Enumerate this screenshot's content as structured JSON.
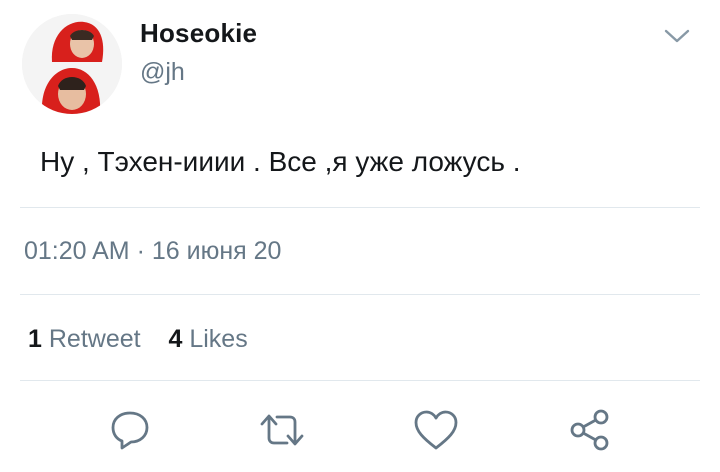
{
  "user": {
    "display_name": "Hoseokie",
    "handle": "@jh"
  },
  "tweet": {
    "text": "Ну , Тэхен-ииии . Все ,я уже ложусь .",
    "timestamp": "01:20 AM · 16 июня 20"
  },
  "stats": {
    "retweets_count": "1",
    "retweets_label": "Retweet",
    "likes_count": "4",
    "likes_label": "Likes"
  },
  "actions": {
    "icons": [
      "reply-icon",
      "retweet-icon",
      "like-icon",
      "share-icon"
    ]
  },
  "colors": {
    "text_primary": "#14171a",
    "text_secondary": "#657786",
    "divider": "#e1e8ed",
    "icon": "#657786",
    "avatar_hood": "#d8201c"
  }
}
